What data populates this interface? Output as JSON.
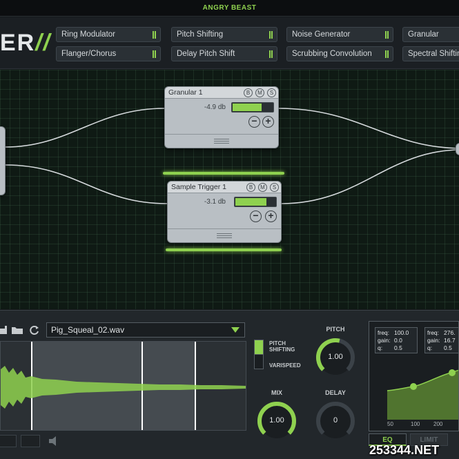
{
  "app": {
    "title": "ANGRY BEAST",
    "logo_text": "ER",
    "logo_slashes": "//"
  },
  "effects": [
    {
      "label": "Ring Modulator"
    },
    {
      "label": "Pitch Shifting"
    },
    {
      "label": "Noise Generator"
    },
    {
      "label": "Granular"
    },
    {
      "label": "Flanger/Chorus"
    },
    {
      "label": "Delay Pitch Shift"
    },
    {
      "label": "Scrubbing Convolution"
    },
    {
      "label": "Spectral Shifting"
    }
  ],
  "nodes": [
    {
      "name": "Granular 1",
      "db": "-4.9 db",
      "level": 0.72,
      "b": "B",
      "m": "M",
      "s": "S",
      "minus": "−",
      "plus": "+"
    },
    {
      "name": "Sample Trigger 1",
      "db": "-3.1 db",
      "level": 0.78,
      "b": "B",
      "m": "M",
      "s": "S",
      "minus": "−",
      "plus": "+"
    }
  ],
  "sampler": {
    "file": "Pig_Squeal_02.wav",
    "pitch_shifting_label": "PITCH SHIFTING",
    "varispeed_label": "VARISPEED",
    "pitch_shifting_on": true
  },
  "knobs": {
    "pitch": {
      "title": "PITCH",
      "value": "1.00",
      "level": 0.55
    },
    "mix": {
      "title": "MIX",
      "value": "1.00",
      "level": 1.0
    },
    "delay": {
      "title": "DELAY",
      "value": "0",
      "level": 0.0
    }
  },
  "eq": {
    "bands": [
      {
        "freq_label": "freq:",
        "freq": "100.0",
        "gain_label": "gain:",
        "gain": "0.0",
        "q_label": "q:",
        "q": "0.5"
      },
      {
        "freq_label": "freq:",
        "freq": "276.",
        "gain_label": "gain:",
        "gain": "16.7",
        "q_label": "q:",
        "q": "0.5"
      }
    ],
    "freq_ticks": [
      "50",
      "100",
      "200"
    ],
    "tabs": [
      {
        "label": "EQ",
        "active": true
      },
      {
        "label": "LIMIT",
        "active": false
      }
    ]
  },
  "watermark": "253344.NET",
  "colors": {
    "accent": "#8fd14f",
    "node": "#b9bfc4",
    "graph_bg": "#0f1a14"
  }
}
